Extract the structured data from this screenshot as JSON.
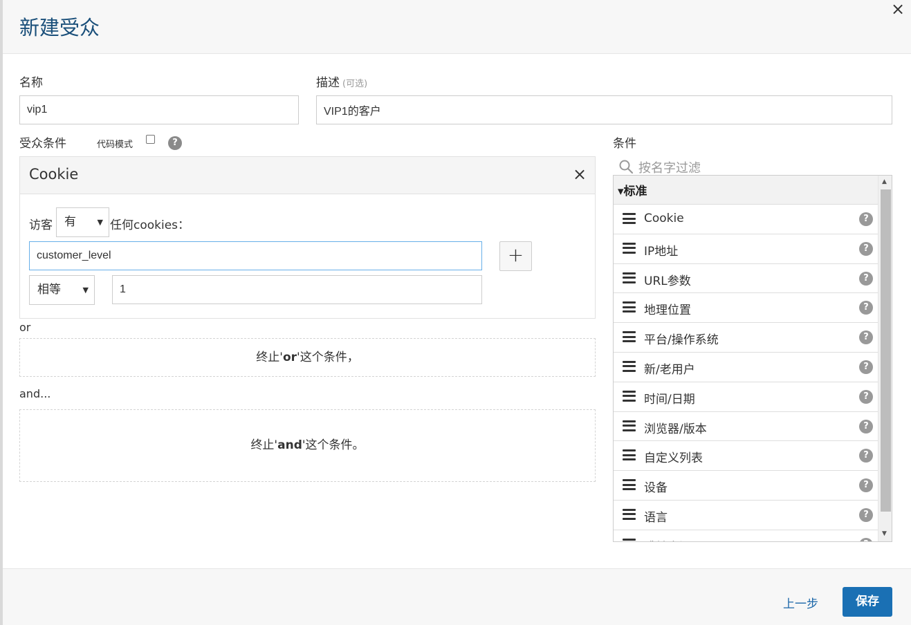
{
  "dialog": {
    "title": "新建受众"
  },
  "form": {
    "name_label": "名称",
    "name_value": "vip1",
    "desc_label": "描述",
    "desc_hint": "(可选)",
    "desc_value": "VIP1的客户"
  },
  "audience": {
    "conditions_label": "受众条件",
    "code_mode_label": "代码模式",
    "help_glyph": "?"
  },
  "cookie_card": {
    "title": "Cookie",
    "visitor_label": "访客",
    "has_select": "有",
    "any_cookies_label": "任何cookies：",
    "cookie_name_value": "customer_level",
    "operator_select": "相等",
    "cookie_value": "1",
    "plus_glyph": "+"
  },
  "or_section": {
    "label": "or",
    "drop_prefix": "终止'",
    "drop_keyword": "or",
    "drop_suffix": "'这个条件，"
  },
  "and_section": {
    "label": "and...",
    "drop_prefix": "终止'",
    "drop_keyword": "and",
    "drop_suffix": "'这个条件。"
  },
  "conditions_panel": {
    "label": "条件",
    "filter_placeholder": "按名字过滤",
    "group_title": "▾标准",
    "items": [
      {
        "label": "Cookie"
      },
      {
        "label": "IP地址"
      },
      {
        "label": "URL参数"
      },
      {
        "label": "地理位置"
      },
      {
        "label": "平台/操作系统"
      },
      {
        "label": "新/老用户"
      },
      {
        "label": "时间/日期"
      },
      {
        "label": "浏览器/版本"
      },
      {
        "label": "自定义列表"
      },
      {
        "label": "设备"
      },
      {
        "label": "语言"
      },
      {
        "label": "跳转来源"
      }
    ]
  },
  "footer": {
    "prev_label": "上一步",
    "save_label": "保存"
  },
  "colors": {
    "title": "#1a4f7a",
    "primary_button": "#1a70b4",
    "link": "#1a66a8"
  }
}
